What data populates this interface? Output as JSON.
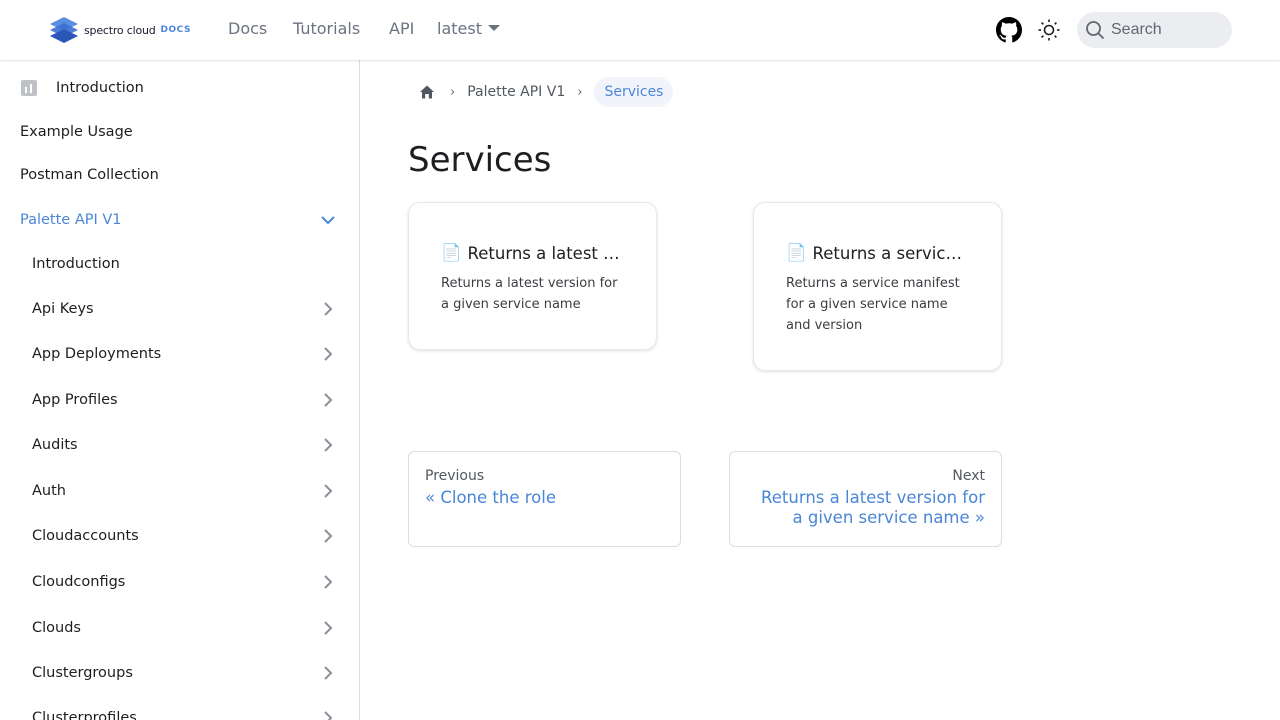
{
  "brand": {
    "name": "spectro cloud",
    "docs": "DOCS",
    "color": "#3b6fd1"
  },
  "navbar": {
    "links": [
      "Docs",
      "Tutorials",
      "API"
    ],
    "version": "latest",
    "search_placeholder": "Search",
    "icons": [
      "github-icon",
      "theme-toggle-icon",
      "search-icon"
    ]
  },
  "sidebar": {
    "top_items": [
      {
        "label": "Introduction",
        "icon": "page-icon"
      },
      {
        "label": "Example Usage"
      },
      {
        "label": "Postman Collection"
      }
    ],
    "active_category": {
      "label": "Palette API V1",
      "expanded": true
    },
    "sub_items": [
      {
        "label": "Introduction",
        "collapsible": false
      },
      {
        "label": "Api Keys",
        "collapsible": true
      },
      {
        "label": "App Deployments",
        "collapsible": true
      },
      {
        "label": "App Profiles",
        "collapsible": true
      },
      {
        "label": "Audits",
        "collapsible": true
      },
      {
        "label": "Auth",
        "collapsible": true
      },
      {
        "label": "Cloudaccounts",
        "collapsible": true
      },
      {
        "label": "Cloudconfigs",
        "collapsible": true
      },
      {
        "label": "Clouds",
        "collapsible": true
      },
      {
        "label": "Clustergroups",
        "collapsible": true
      },
      {
        "label": "Clusterprofiles",
        "collapsible": true
      }
    ]
  },
  "breadcrumb": {
    "items": [
      "Palette API V1",
      "Services"
    ]
  },
  "page": {
    "title": "Services",
    "cards": [
      {
        "title": "Returns a latest v…",
        "description": "Returns a latest version for a given service name",
        "icon": "📄"
      },
      {
        "title": "Returns a service …",
        "description": "Returns a service manifest for a given service name and version",
        "icon": "📄"
      }
    ],
    "pager": {
      "previous_sub": "Previous",
      "previous_label": "« Clone the role",
      "next_sub": "Next",
      "next_label": "Returns a latest version for a given service name »"
    }
  },
  "colors": {
    "accent": "#4a86d8",
    "text": "#1c1e21",
    "muted": "#606770"
  }
}
